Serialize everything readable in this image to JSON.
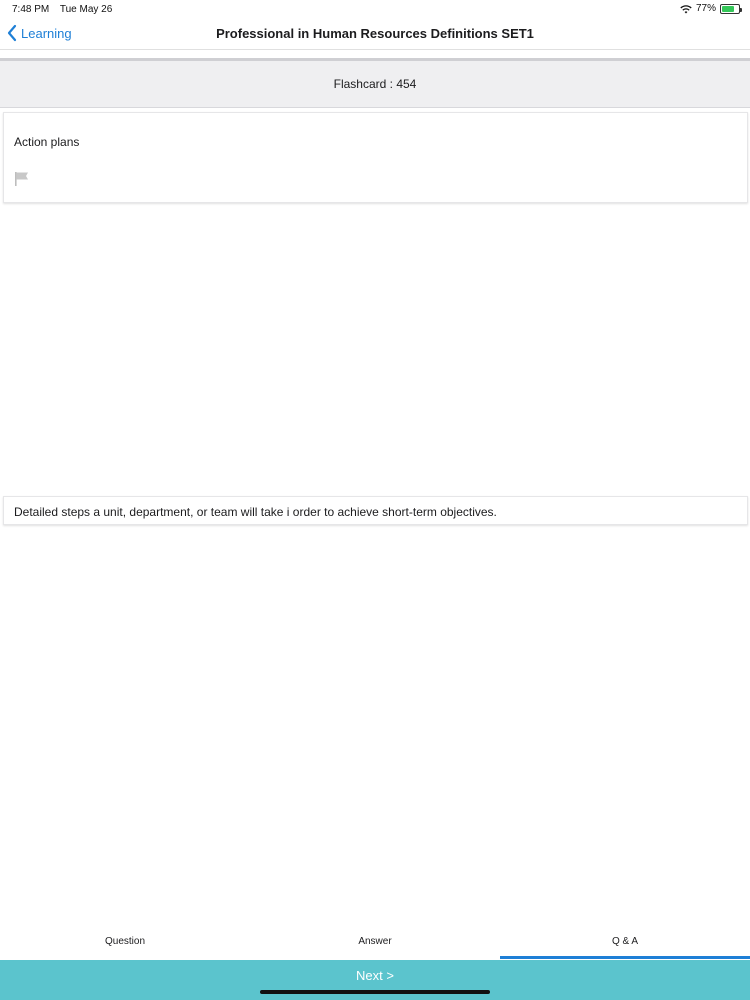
{
  "status_bar": {
    "time": "7:48 PM",
    "date": "Tue May 26",
    "battery_percent": "77%",
    "battery_level": 0.77,
    "icons": [
      "wifi-icon",
      "battery-icon"
    ]
  },
  "nav": {
    "back_label": "Learning",
    "title": "Professional in Human Resources Definitions SET1",
    "back_icon": "chevron-left-icon"
  },
  "flashcard": {
    "header": "Flashcard : 454",
    "question": "Action plans",
    "flag_icon": "flag-icon",
    "answer": "Detailed steps a unit, department, or team will take i order to achieve short-term objectives."
  },
  "tabs": [
    {
      "label": "Question",
      "active": false
    },
    {
      "label": "Answer",
      "active": false
    },
    {
      "label": "Q & A",
      "active": true
    }
  ],
  "next_label": "Next >",
  "colors": {
    "accent": "#1e7fd6",
    "next_bar": "#5bc4cd",
    "header_bg": "#efeff1",
    "battery": "#34c759"
  }
}
